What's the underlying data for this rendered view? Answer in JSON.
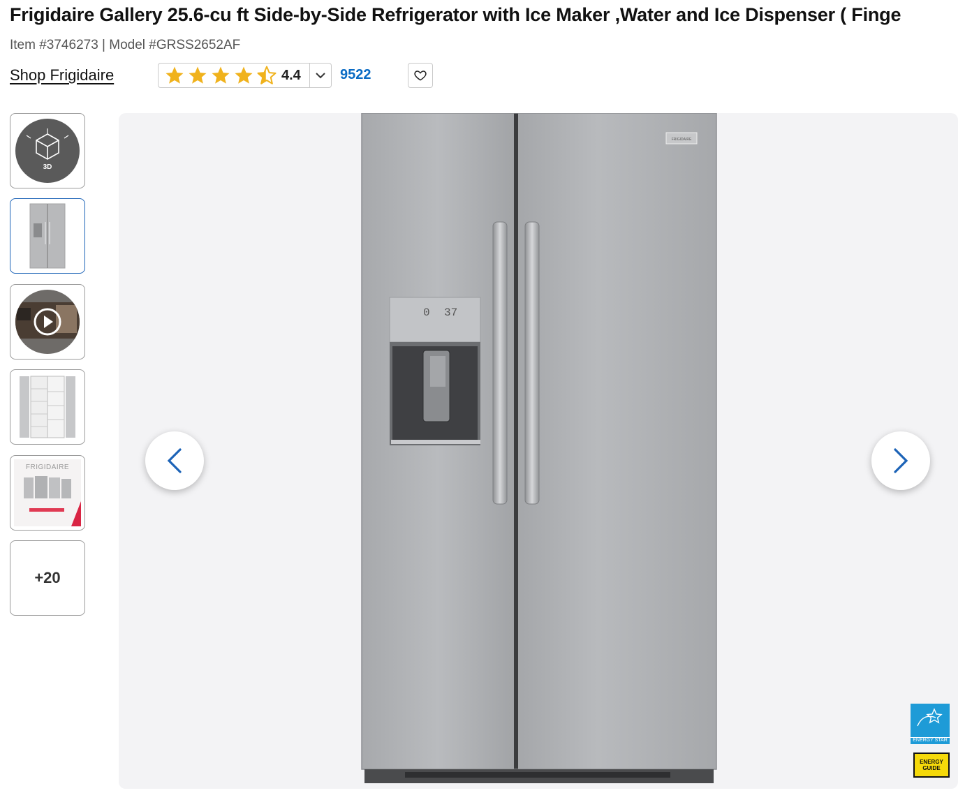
{
  "product": {
    "title": "Frigidaire Gallery 25.6-cu ft Side-by-Side Refrigerator with Ice Maker ,Water and Ice Dispenser ( Finge",
    "item_label": "Item #3746273",
    "separator": " | ",
    "model_label": "Model #GRSS2652AF",
    "shop_link": "Shop Frigidaire"
  },
  "rating": {
    "value": "4.4",
    "stars_filled": 4.4,
    "review_count": "9522",
    "star_color": "#f0b21c"
  },
  "gallery": {
    "thumbnails": [
      {
        "kind": "3d",
        "badge": "3D"
      },
      {
        "kind": "image",
        "subject": "refrigerator-front"
      },
      {
        "kind": "video",
        "subject": "kitchen-video"
      },
      {
        "kind": "image",
        "subject": "refrigerator-open"
      },
      {
        "kind": "image",
        "subject": "brand-promo",
        "brand": "FRIGIDAIRE"
      }
    ],
    "more_label": "+20",
    "active_index": 1
  },
  "main_image": {
    "subject": "stainless side-by-side refrigerator",
    "badge_brand": "FRIGIDAIRE",
    "display_left": "0",
    "display_right": "37",
    "energy_star_label": "ENERGY STAR",
    "energy_guide_label": "ENERGY GUIDE"
  },
  "colors": {
    "link_blue": "#0a6bc4",
    "active_border": "#1c63b7",
    "energy_star_blue": "#1e9bd7",
    "energy_guide_yellow": "#f5d90a"
  }
}
